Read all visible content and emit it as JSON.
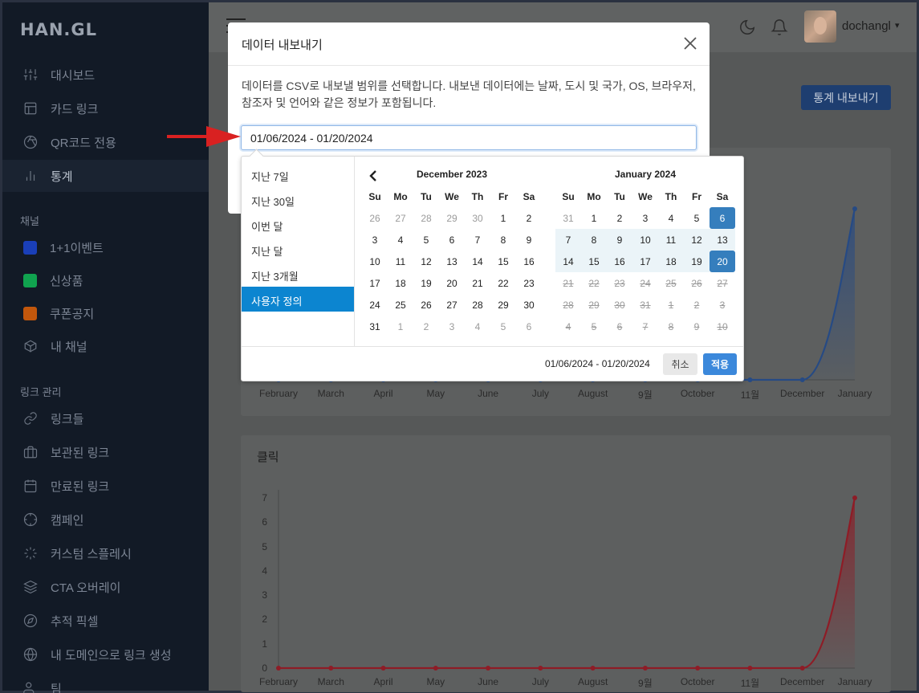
{
  "app": {
    "logo": "HAN.GL"
  },
  "sidebar": {
    "items": [
      {
        "label": "대시보드",
        "icon": "sliders-icon"
      },
      {
        "label": "카드 링크",
        "icon": "layout-icon"
      },
      {
        "label": "QR코드 전용",
        "icon": "aperture-icon"
      },
      {
        "label": "통계",
        "icon": "bar-chart-icon",
        "active": true
      }
    ],
    "channels_label": "채널",
    "channels": [
      {
        "label": "1+1이벤트",
        "color": "#1a3fb8"
      },
      {
        "label": "신상품",
        "color": "#10a34f"
      },
      {
        "label": "쿠폰공지",
        "color": "#c2570c"
      },
      {
        "label": "내 채널",
        "icon": "box-icon"
      }
    ],
    "links_label": "링크 관리",
    "links": [
      {
        "label": "링크들",
        "icon": "link-icon"
      },
      {
        "label": "보관된 링크",
        "icon": "briefcase-icon"
      },
      {
        "label": "만료된 링크",
        "icon": "calendar-icon"
      },
      {
        "label": "캠페인",
        "icon": "crosshair-icon"
      },
      {
        "label": "커스텀 스플레시",
        "icon": "loader-icon"
      },
      {
        "label": "CTA 오버레이",
        "icon": "layers-icon"
      },
      {
        "label": "추적 픽셀",
        "icon": "compass-icon"
      },
      {
        "label": "내 도메인으로 링크 생성",
        "icon": "globe-icon"
      },
      {
        "label": "팀",
        "icon": "users-icon"
      }
    ]
  },
  "header": {
    "username": "dochangl",
    "export_label": "통계 내보내기"
  },
  "charts": {
    "months": [
      "February",
      "March",
      "April",
      "May",
      "June",
      "July",
      "August",
      "9월",
      "October",
      "11월",
      "December",
      "January"
    ],
    "clicks_title": "클릭"
  },
  "chart_data": [
    {
      "type": "area",
      "title": "",
      "categories": [
        "February",
        "March",
        "April",
        "May",
        "June",
        "July",
        "August",
        "9월",
        "October",
        "11월",
        "December",
        "January"
      ],
      "series": [
        {
          "values": [
            0,
            0,
            0,
            0,
            0,
            0,
            0,
            0,
            0,
            0,
            0,
            null
          ],
          "color": "#2c5aa0"
        }
      ],
      "note_visible_portion": "mostly hidden behind modal; final point highest"
    },
    {
      "type": "area",
      "title": "클릭",
      "categories": [
        "February",
        "March",
        "April",
        "May",
        "June",
        "July",
        "August",
        "9월",
        "October",
        "11월",
        "December",
        "January"
      ],
      "series": [
        {
          "values": [
            0,
            0,
            0,
            0,
            0,
            0,
            0,
            0,
            0,
            0,
            0,
            7
          ],
          "color": "#a01e2a"
        }
      ],
      "ylim": [
        0,
        7
      ],
      "yticks": [
        0,
        1,
        2,
        3,
        4,
        5,
        6,
        7
      ]
    }
  ],
  "modal": {
    "title": "데이터 내보내기",
    "description": "데이터를 CSV로 내보낼 범위를 선택합니다. 내보낸 데이터에는 날짜, 도시 및 국가, OS, 브라우저, 참조자 및 언어와 같은 정보가 포함됩니다.",
    "date_value": "01/06/2024 - 01/20/2024"
  },
  "picker": {
    "ranges": [
      "지난 7일",
      "지난 30일",
      "이번 달",
      "지난 달",
      "지난 3개월",
      "사용자 정의"
    ],
    "active_range": 5,
    "weekdays": [
      "Su",
      "Mo",
      "Tu",
      "We",
      "Th",
      "Fr",
      "Sa"
    ],
    "left": {
      "title": "December 2023",
      "days": [
        [
          "26",
          "27",
          "28",
          "29",
          "30",
          "1",
          "2"
        ],
        [
          "3",
          "4",
          "5",
          "6",
          "7",
          "8",
          "9"
        ],
        [
          "10",
          "11",
          "12",
          "13",
          "14",
          "15",
          "16"
        ],
        [
          "17",
          "18",
          "19",
          "20",
          "21",
          "22",
          "23"
        ],
        [
          "24",
          "25",
          "26",
          "27",
          "28",
          "29",
          "30"
        ],
        [
          "31",
          "1",
          "2",
          "3",
          "4",
          "5",
          "6"
        ]
      ]
    },
    "right": {
      "title": "January 2024",
      "days": [
        [
          "31",
          "1",
          "2",
          "3",
          "4",
          "5",
          "6"
        ],
        [
          "7",
          "8",
          "9",
          "10",
          "11",
          "12",
          "13"
        ],
        [
          "14",
          "15",
          "16",
          "17",
          "18",
          "19",
          "20"
        ],
        [
          "21",
          "22",
          "23",
          "24",
          "25",
          "26",
          "27"
        ],
        [
          "28",
          "29",
          "30",
          "31",
          "1",
          "2",
          "3"
        ],
        [
          "4",
          "5",
          "6",
          "7",
          "8",
          "9",
          "10"
        ]
      ]
    },
    "footer_range": "01/06/2024 - 01/20/2024",
    "cancel_label": "취소",
    "apply_label": "적용"
  }
}
